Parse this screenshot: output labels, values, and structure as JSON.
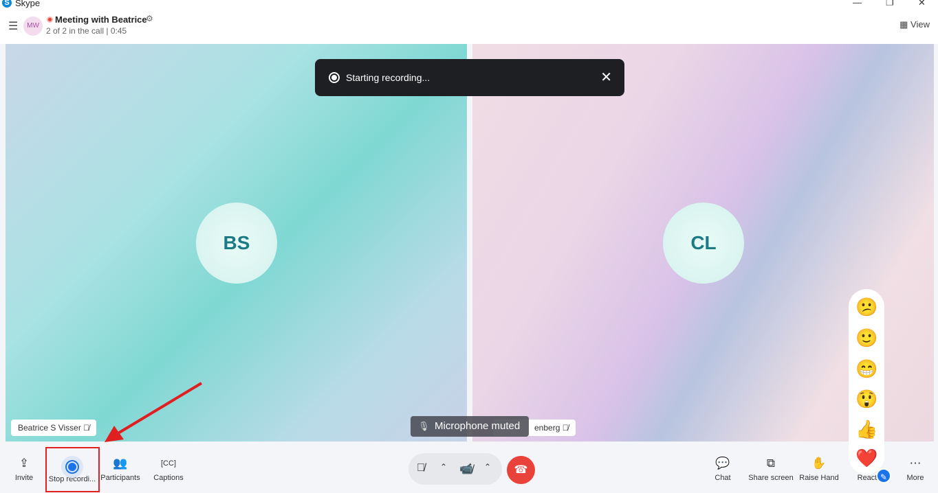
{
  "window": {
    "app_title": "Skype",
    "logo": "S",
    "minimize": "—",
    "maximize": "❐",
    "close": "✕"
  },
  "header": {
    "avatar": "MW",
    "title": "Meeting with Beatrice",
    "subtitle": "2 of 2 in the call | 0:45",
    "view_label": "View",
    "view_icon": "▦"
  },
  "participants": [
    {
      "initials": "BS",
      "name": "Beatrice S Visser"
    },
    {
      "initials": "CL",
      "name_visible": "enberg"
    }
  ],
  "toast": {
    "text": "Starting recording...",
    "close": "✕"
  },
  "mic_toast": {
    "text": "Microphone muted"
  },
  "toolbar": {
    "invite": "Invite",
    "stop_recording": "Stop recordi...",
    "participants": "Participants",
    "captions": "Captions",
    "chat": "Chat",
    "share_screen": "Share screen",
    "raise_hand": "Raise Hand",
    "react": "React",
    "more": "More"
  },
  "reactions": [
    "😕",
    "🙂",
    "😁",
    "😲",
    "👍",
    "❤️"
  ],
  "colors": {
    "recording": "#1a73e8",
    "hangup": "#e8423a",
    "highlight": "#e02020"
  }
}
